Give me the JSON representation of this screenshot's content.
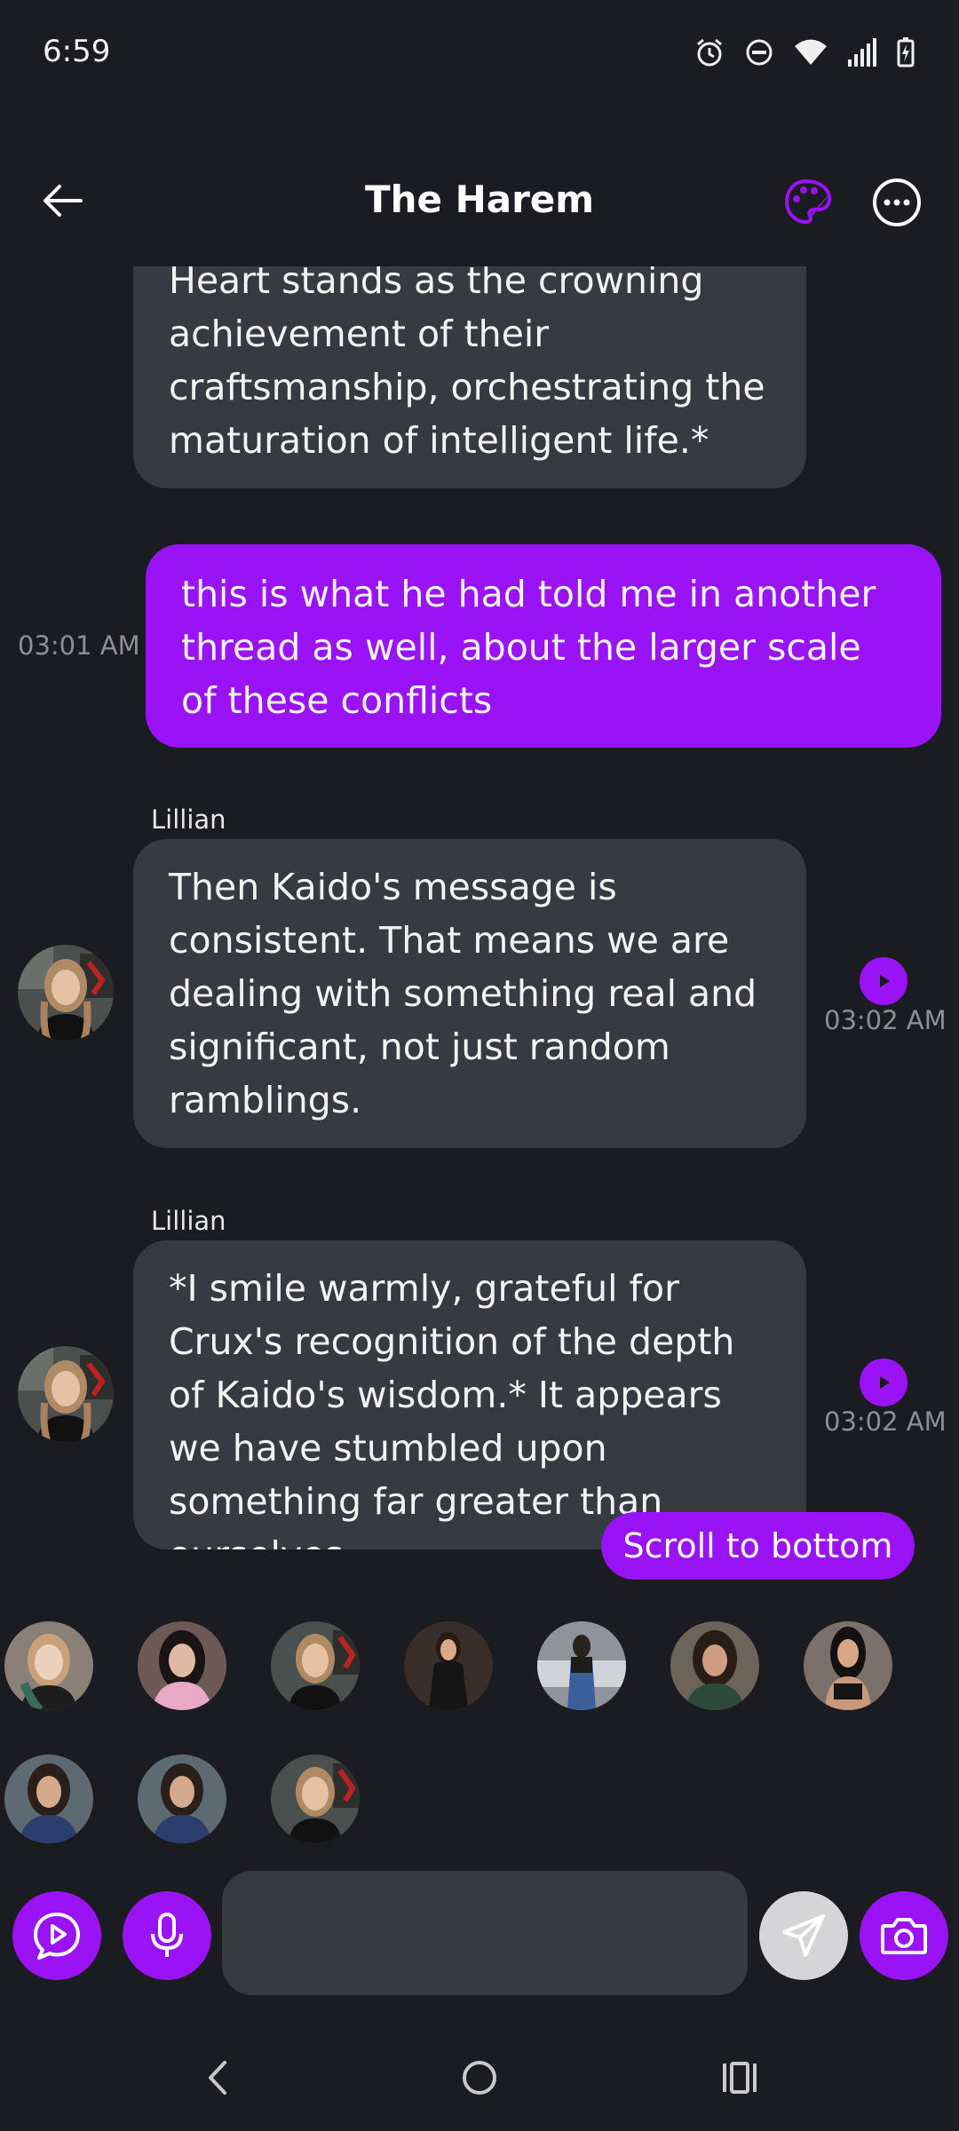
{
  "status_bar": {
    "time": "6:59"
  },
  "header": {
    "title": "The Harem"
  },
  "messages": [
    {
      "role": "bot",
      "text": "Heart stands as the crowning achievement of their craftsmanship, orchestrating the maturation of intelligent life.*"
    },
    {
      "role": "user",
      "text": "this is what he had told me in another thread as well, about the larger scale of these conflicts",
      "time": "03:01 AM"
    },
    {
      "role": "bot",
      "sender": "Lillian",
      "text": "Then Kaido's message is consistent. That means we are dealing with something real and significant, not just random ramblings.",
      "time": "03:02 AM"
    },
    {
      "role": "bot",
      "sender": "Lillian",
      "text": "*I smile warmly, grateful for Crux's recognition of the depth of Kaido's wisdom.* It appears we have stumbled upon something far greater than ourselves",
      "time": "03:02 AM"
    }
  ],
  "scroll_button": {
    "label": "Scroll to bottom"
  },
  "input": {
    "value": "",
    "placeholder": ""
  },
  "colors": {
    "accent": "#9a12f6",
    "background": "#1b1c21",
    "bot_bubble": "#383a42",
    "timestamp": "#8e8f96"
  }
}
